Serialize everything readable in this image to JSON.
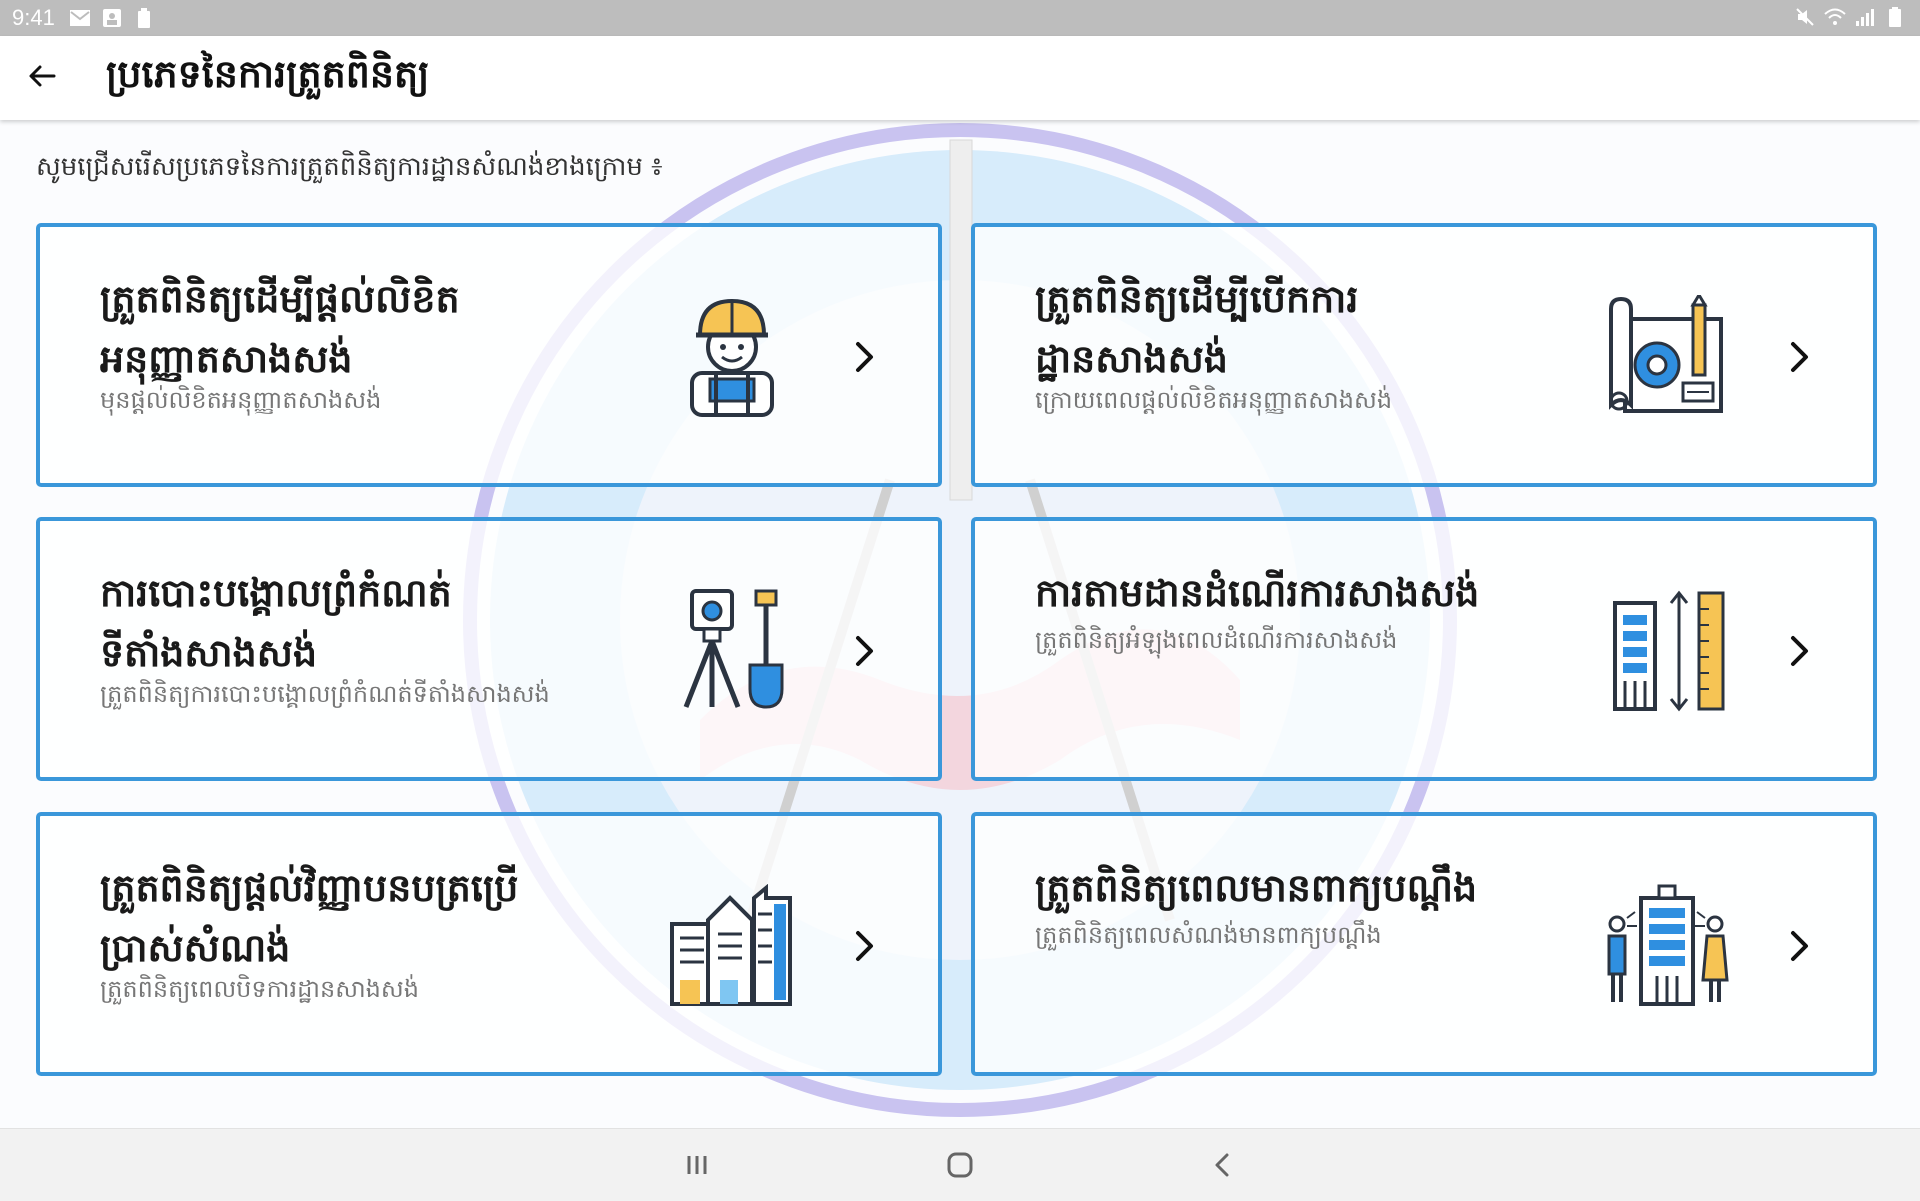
{
  "status_bar": {
    "time": "9:41",
    "left_icons": [
      "gmail-icon",
      "photo-icon",
      "battery-saver-icon"
    ],
    "right_icons": [
      "mute-icon",
      "wifi-icon",
      "signal-icon",
      "battery-icon"
    ]
  },
  "app_bar": {
    "title": "ប្រភេទនៃការត្រួតពិនិត្យ",
    "back_icon": "arrow-left-icon"
  },
  "instruction": "សូមជ្រើសរើសប្រភេទនៃការត្រួតពិនិត្យការដ្ឋានសំណង់ខាងក្រោម ៖",
  "cards": [
    {
      "title_line1": "ត្រួតពិនិត្យដើម្បីផ្ដល់លិខិត",
      "title_line2": "អនុញ្ញាតសាងសង់",
      "subtitle": "មុនផ្ដល់លិខិតអនុញ្ញាតសាងសង់",
      "icon": "construction-worker-icon"
    },
    {
      "title_line1": "ត្រួតពិនិត្យដើម្បីបើកការ",
      "title_line2": "ដ្ឋានសាងសង់",
      "subtitle": "ក្រោយពេលផ្ដល់លិខិតអនុញ្ញាតសាងសង់",
      "icon": "blueprint-icon"
    },
    {
      "title_line1": "ការបោះបង្គោលព្រំកំណត់",
      "title_line2": "ទីតាំងសាងសង់",
      "subtitle": "ត្រួតពិនិត្យការបោះបង្គោលព្រំកំណត់ទីតាំងសាងសង់",
      "icon": "surveying-tools-icon"
    },
    {
      "title_line1": "ការតាមដានដំណើរការសាងសង់",
      "title_line2": "",
      "subtitle": "ត្រួតពិនិត្យអំឡុងពេលដំណើរការសាងសង់",
      "icon": "building-height-icon"
    },
    {
      "title_line1": "ត្រួតពិនិត្យផ្ដល់វិញ្ញាបនបត្រប្រើ",
      "title_line2": "ប្រាស់សំណង់",
      "subtitle": "ត្រួតពិនិត្យពេលបិទការដ្ឋានសាងសង់",
      "icon": "city-buildings-icon"
    },
    {
      "title_line1": "ត្រួតពិនិត្យពេលមានពាក្យបណ្ដឹង",
      "title_line2": "",
      "subtitle": "ត្រួតពិនិត្យពេលសំណង់មានពាក្យបណ្ដឹង",
      "icon": "building-complaint-icon"
    }
  ],
  "colors": {
    "card_border": "#3a97da",
    "accent_blue": "#2f8fe0",
    "accent_yellow": "#f6c454",
    "icon_dark": "#2b3441"
  },
  "nav_bar": {
    "buttons": [
      "recents-icon",
      "home-icon",
      "back-icon"
    ]
  }
}
